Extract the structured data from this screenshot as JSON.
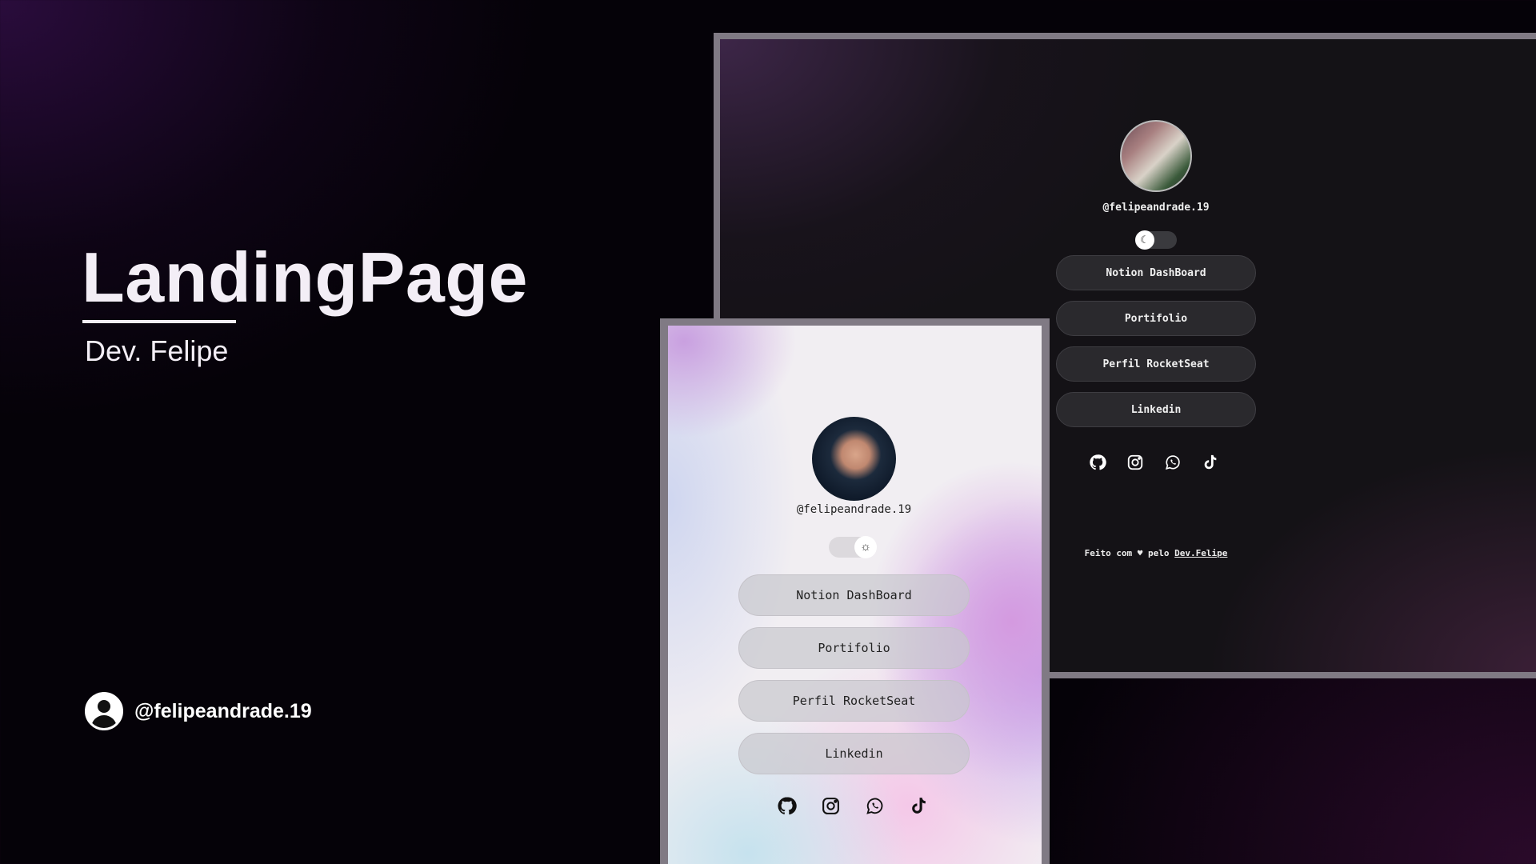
{
  "hero": {
    "title": "LandingPage",
    "subtitle": "Dev. Felipe",
    "handle": "@felipeandrade.19"
  },
  "dark_preview": {
    "handle": "@felipeandrade.19",
    "theme": "dark",
    "toggle_icon": "moon-icon",
    "buttons": [
      "Notion DashBoard",
      "Portifolio",
      "Perfil RocketSeat",
      "Linkedin"
    ],
    "social_icons": [
      "github-icon",
      "instagram-icon",
      "whatsapp-icon",
      "tiktok-icon"
    ],
    "footer_prefix": "Feito com ♥ pelo ",
    "footer_link": "Dev.Felipe"
  },
  "light_preview": {
    "handle": "@felipeandrade.19",
    "theme": "light",
    "toggle_icon": "sun-icon",
    "buttons": [
      "Notion DashBoard",
      "Portifolio",
      "Perfil RocketSeat",
      "Linkedin"
    ],
    "social_icons": [
      "github-icon",
      "instagram-icon",
      "whatsapp-icon",
      "tiktok-icon"
    ]
  },
  "colors": {
    "background": "#050208",
    "accent_purple": "#2a0c3c",
    "frame": "#807a84"
  }
}
